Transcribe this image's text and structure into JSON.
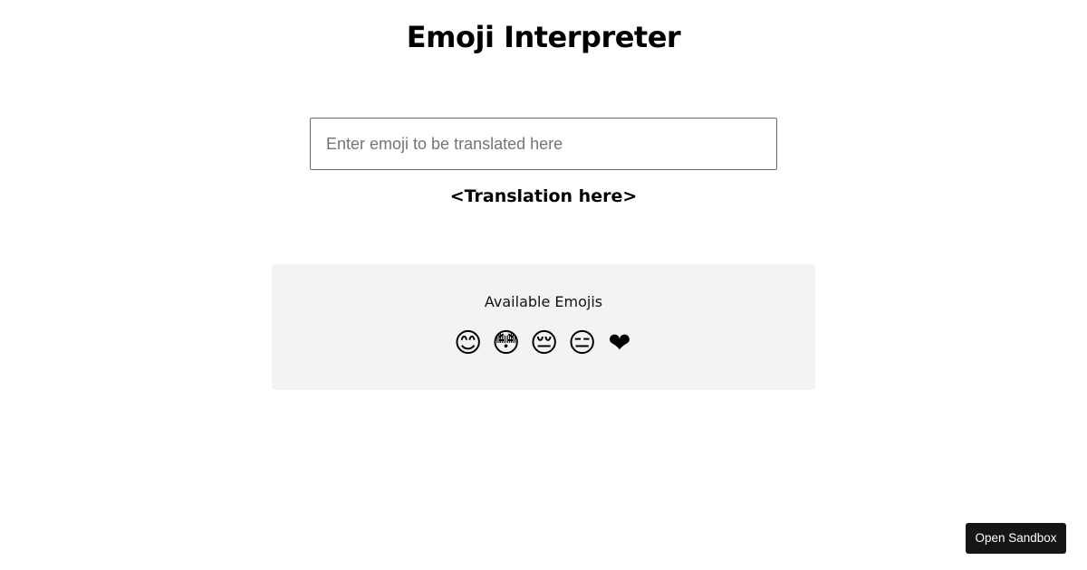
{
  "header": {
    "title": "Emoji Interpreter"
  },
  "input": {
    "value": "",
    "placeholder": "Enter emoji to be translated here"
  },
  "translation": {
    "text": "<Translation here>"
  },
  "emoji_panel": {
    "heading": "Available Emojis",
    "emojis": [
      "😊",
      "😳",
      "😔",
      "😑",
      "❤"
    ]
  },
  "sandbox_button": {
    "label": "Open Sandbox"
  }
}
